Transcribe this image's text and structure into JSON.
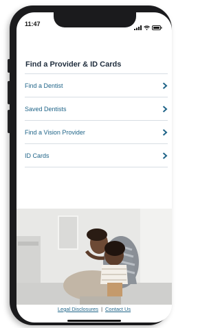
{
  "status_bar": {
    "time": "11:47"
  },
  "page": {
    "title": "Find a Provider & ID Cards"
  },
  "menu": {
    "items": [
      {
        "label": "Find a Dentist"
      },
      {
        "label": "Saved Dentists"
      },
      {
        "label": "Find a Vision Provider"
      },
      {
        "label": "ID Cards"
      }
    ]
  },
  "footer": {
    "legal_label": "Legal Disclosures",
    "separator": "|",
    "contact_label": "Contact Us"
  },
  "colors": {
    "link": "#1f6488",
    "title": "#1f2d3d",
    "divider": "#d7dde3"
  },
  "icons": {
    "chevron": "chevron-right-icon",
    "signal": "signal-icon",
    "wifi": "wifi-icon",
    "battery": "battery-icon"
  }
}
